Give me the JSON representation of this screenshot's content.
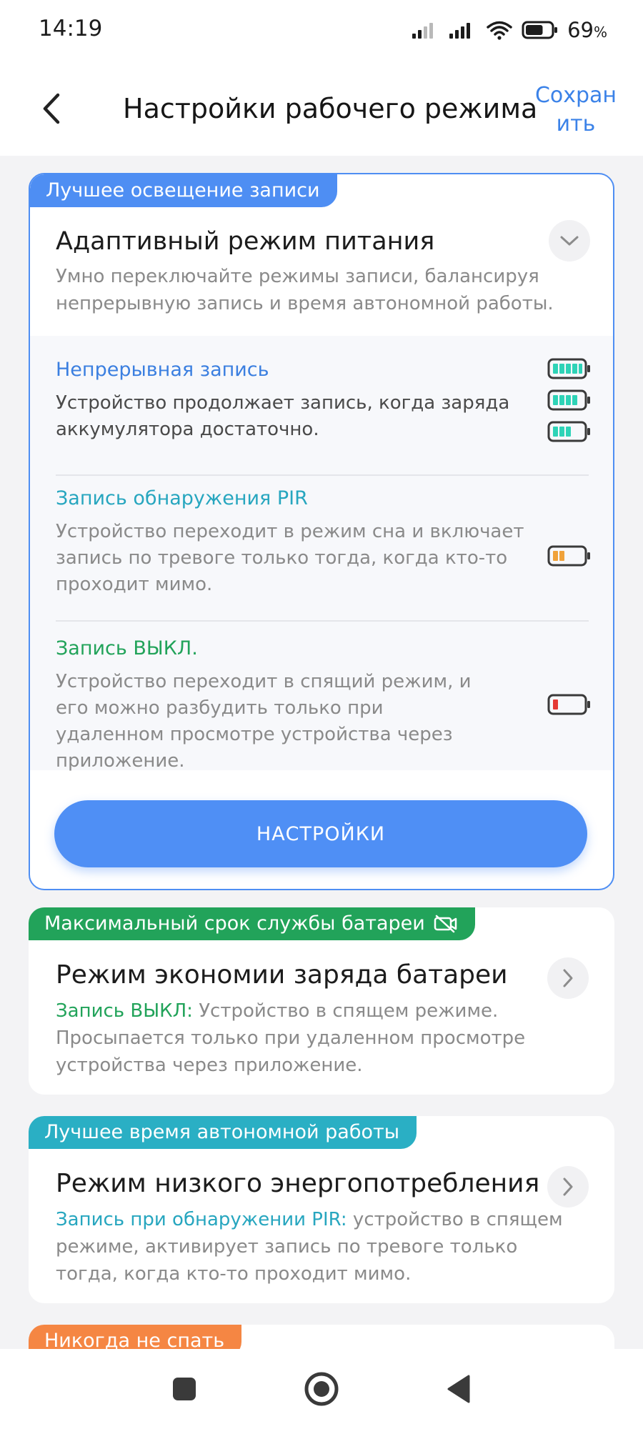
{
  "status_bar": {
    "time": "14:19",
    "battery_percent": "69",
    "battery_unit": "%",
    "battery_level": 0.69
  },
  "header": {
    "title": "Настройки рабочего режима",
    "save_label": "Сохранить"
  },
  "adaptive": {
    "tag": "Лучшее освещение записи",
    "title": "Адаптивный режим питания",
    "description": "Умно переключайте режимы записи, балансируя непрерывную запись и время автономной работы.",
    "modes": [
      {
        "title": "Непрерывная запись",
        "description": "Устройство продолжает запись, когда заряда аккумулятора достаточно.",
        "color": "#3b7fe0"
      },
      {
        "title": "Запись обнаружения PIR",
        "description": "Устройство переходит в режим сна и включает запись по тревоге только тогда, когда кто-то проходит мимо.",
        "color": "#27a6bf"
      },
      {
        "title": "Запись ВЫКЛ.",
        "description": "Устройство переходит в спящий режим, и его можно разбудить только при удаленном просмотре устройства через приложение.",
        "color": "#22a35a"
      }
    ],
    "settings_button": "НАСТРОЙКИ"
  },
  "battery_saver": {
    "tag": "Максимальный срок службы батареи",
    "title": "Режим экономии заряда батареи",
    "highlight": "Запись ВЫКЛ:",
    "description": " Устройство в спящем режиме. Просыпается только при удаленном просмотре устройства через приложение."
  },
  "low_power": {
    "tag": "Лучшее время автономной работы",
    "title": "Режим низкого энергопотребления",
    "highlight": "Запись при обнаружении PIR:",
    "description": " устройство в спящем режиме, активирует запись по тревоге только тогда, когда кто-то проходит мимо."
  },
  "never_sleep": {
    "tag": "Никогда не спать"
  },
  "colors": {
    "accent": "#4e8ef3",
    "green": "#22a35a",
    "teal": "#2aafc4",
    "orange": "#f58643",
    "battery_full": "#2ed3b7",
    "battery_mid": "#f0a23a",
    "battery_low": "#e53935"
  }
}
